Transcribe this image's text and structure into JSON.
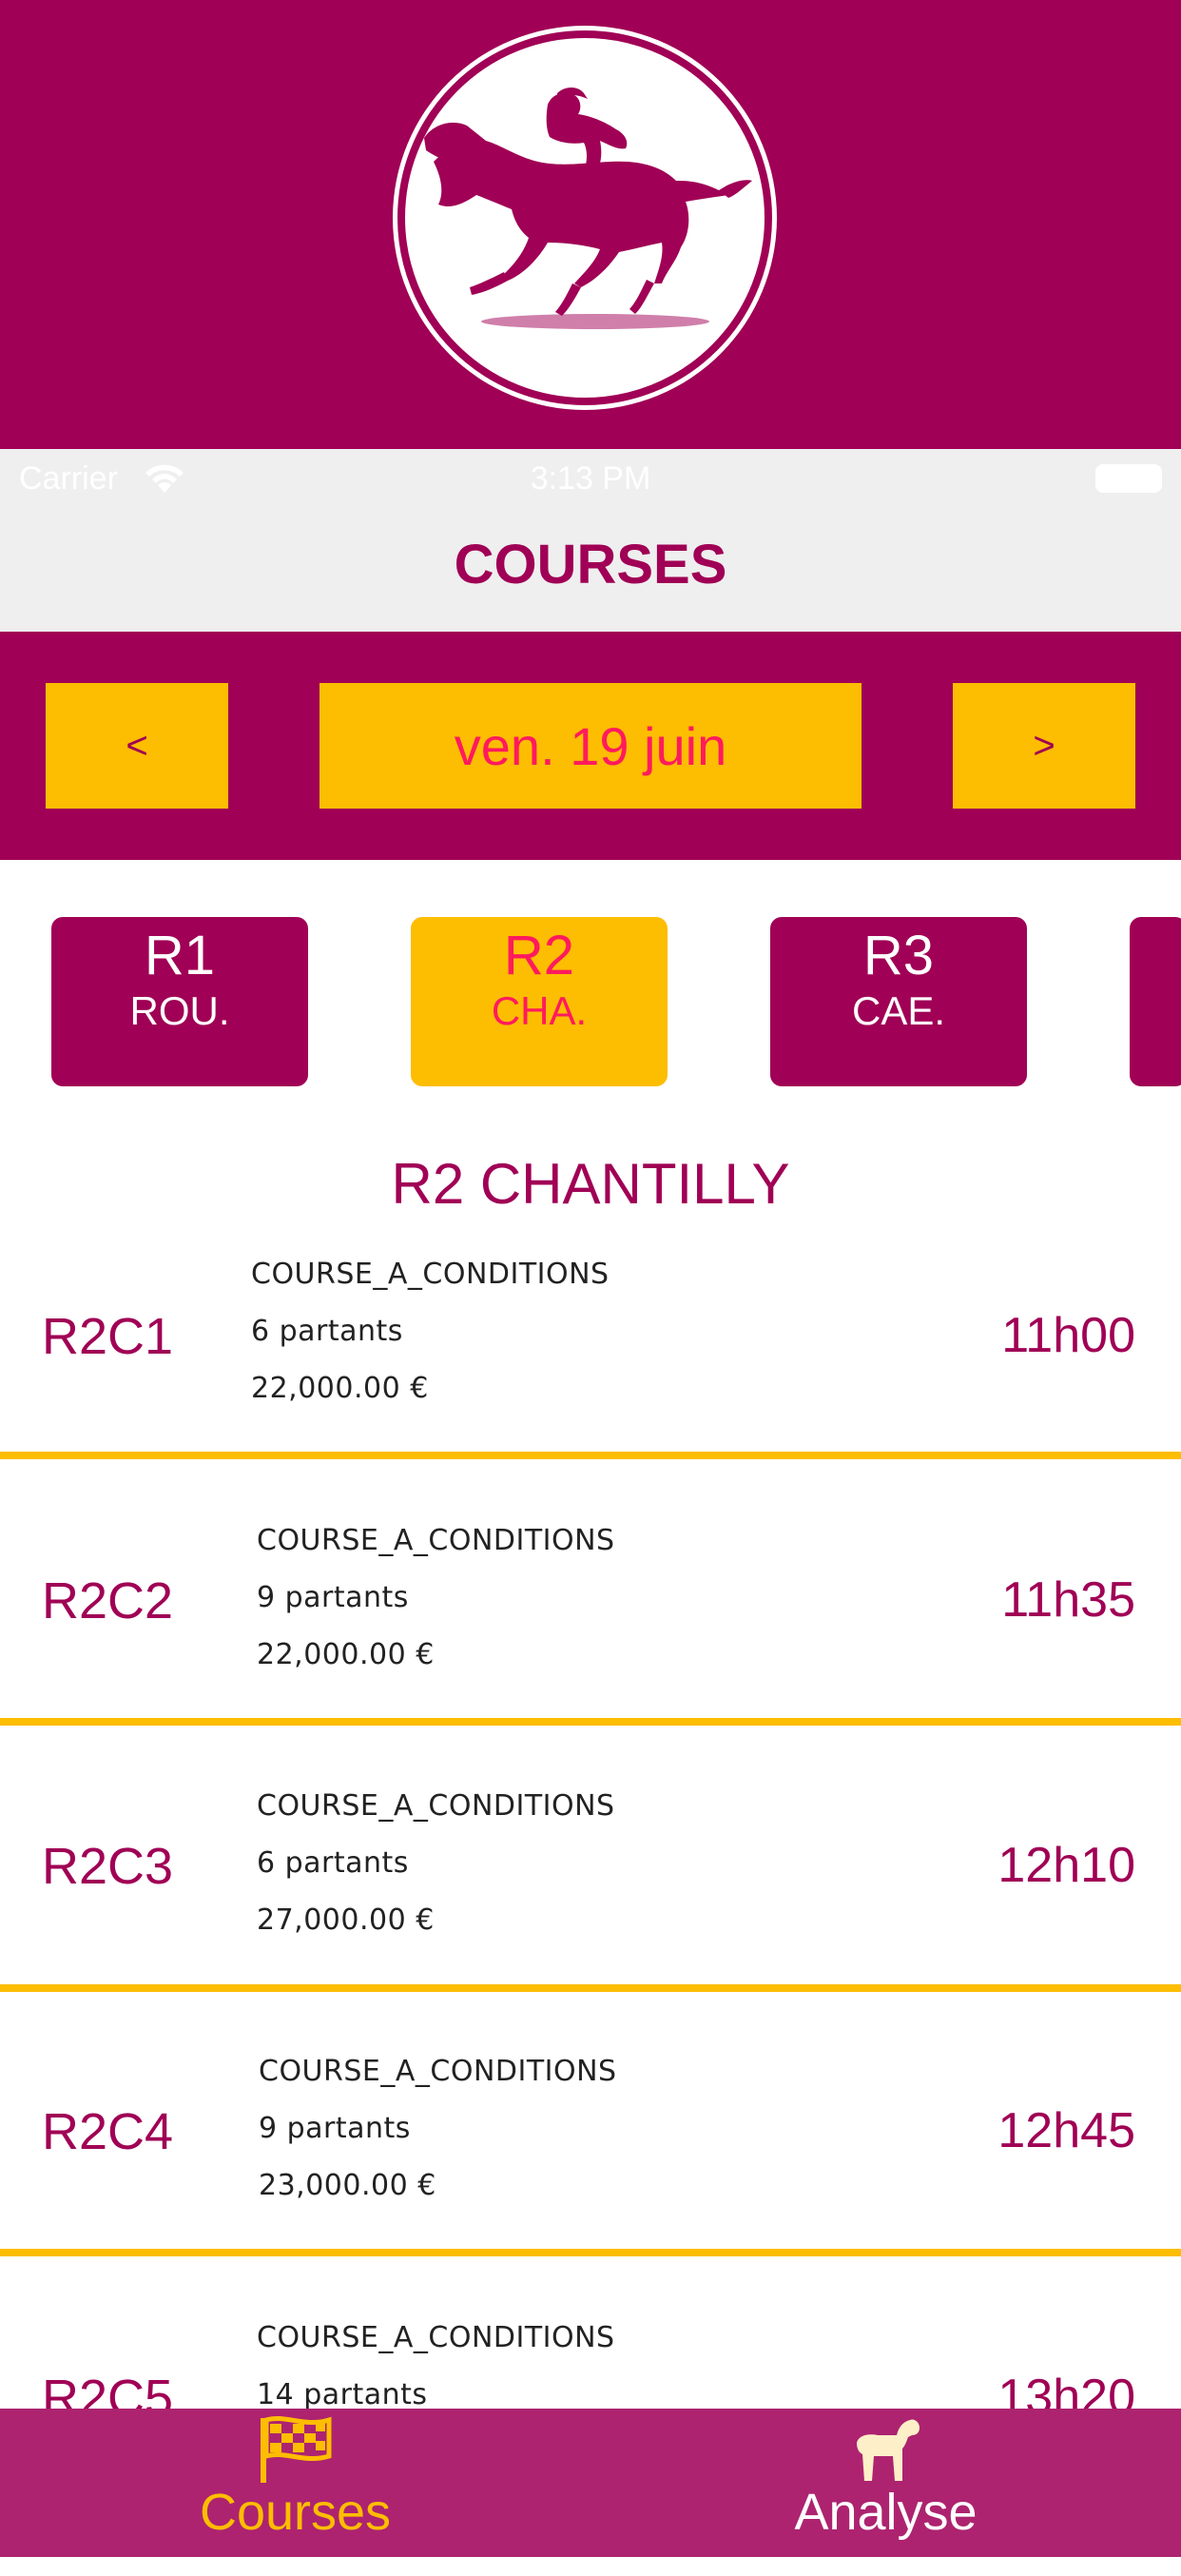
{
  "status_bar": {
    "carrier": "Carrier",
    "time": "3:13 PM"
  },
  "nav": {
    "title": "COURSES"
  },
  "date_selector": {
    "prev_label": "<",
    "date": "ven. 19 juin",
    "next_label": ">"
  },
  "reunions": [
    {
      "code": "R1",
      "name": "ROU.",
      "selected": false
    },
    {
      "code": "R2",
      "name": "CHA.",
      "selected": true
    },
    {
      "code": "R3",
      "name": "CAE.",
      "selected": false
    }
  ],
  "reunion_title": "R2 CHANTILLY",
  "races": [
    {
      "id": "R2C1",
      "type": "COURSE_A_CONDITIONS",
      "partants": "6 partants",
      "prize": "22,000.00 €",
      "time": "11h00"
    },
    {
      "id": "R2C2",
      "type": "COURSE_A_CONDITIONS",
      "partants": "9 partants",
      "prize": "22,000.00 €",
      "time": "11h35"
    },
    {
      "id": "R2C3",
      "type": "COURSE_A_CONDITIONS",
      "partants": "6 partants",
      "prize": "27,000.00 €",
      "time": "12h10"
    },
    {
      "id": "R2C4",
      "type": "COURSE_A_CONDITIONS",
      "partants": "9 partants",
      "prize": "23,000.00 €",
      "time": "12h45"
    },
    {
      "id": "R2C5",
      "type": "COURSE_A_CONDITIONS",
      "partants": "14 partants",
      "prize": "",
      "time": "13h20"
    }
  ],
  "tabs": {
    "courses_label": "Courses",
    "analyse_label": "Analyse"
  },
  "colors": {
    "brand": "#a00055",
    "accent": "#fdbd00",
    "highlight": "#ff1a5e",
    "tabbar": "#ad2370"
  },
  "icons": {
    "logo": "galloping-horse-jockey-icon",
    "courses_tab": "checkered-flag-icon",
    "analyse_tab": "horse-icon"
  }
}
